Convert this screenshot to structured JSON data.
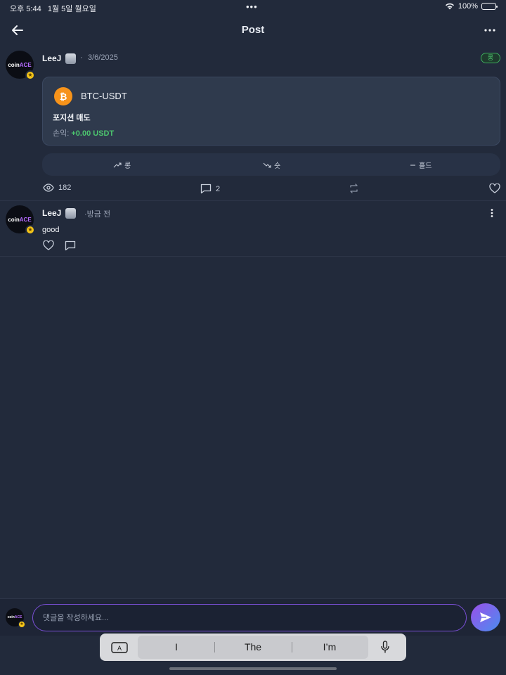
{
  "status_bar": {
    "time": "오후 5:44",
    "date": "1월 5일 월요일",
    "dots": "•••",
    "battery": "100%"
  },
  "nav": {
    "title": "Post"
  },
  "post": {
    "avatar_text_coin": "coin",
    "avatar_text_ace": "ACE",
    "username": "LeeJ",
    "separator": "·",
    "date": "3/6/2025",
    "sentiment": "롱",
    "card": {
      "coin_symbol": "₿",
      "pair": "BTC-USDT",
      "position": "포지션 매도",
      "pnl_label": "손익:",
      "pnl_value": "+0.00 USDT"
    },
    "votes": {
      "long": "롱",
      "short": "숏",
      "hold": "홀드"
    },
    "stats": {
      "views": "182",
      "comments": "2"
    }
  },
  "comment": {
    "avatar_text_coin": "coin",
    "avatar_text_ace": "ACE",
    "username": "LeeJ",
    "time": "·방금 전",
    "text": "good"
  },
  "composer": {
    "placeholder": "댓글을 작성하세요..."
  },
  "keyboard": {
    "suggestions": [
      "I",
      "The",
      "I’m"
    ]
  },
  "colors": {
    "background": "#222a3b",
    "accent_green": "#4cc46e",
    "accent_purple": "#7a4fd6",
    "bitcoin": "#f7931a"
  }
}
